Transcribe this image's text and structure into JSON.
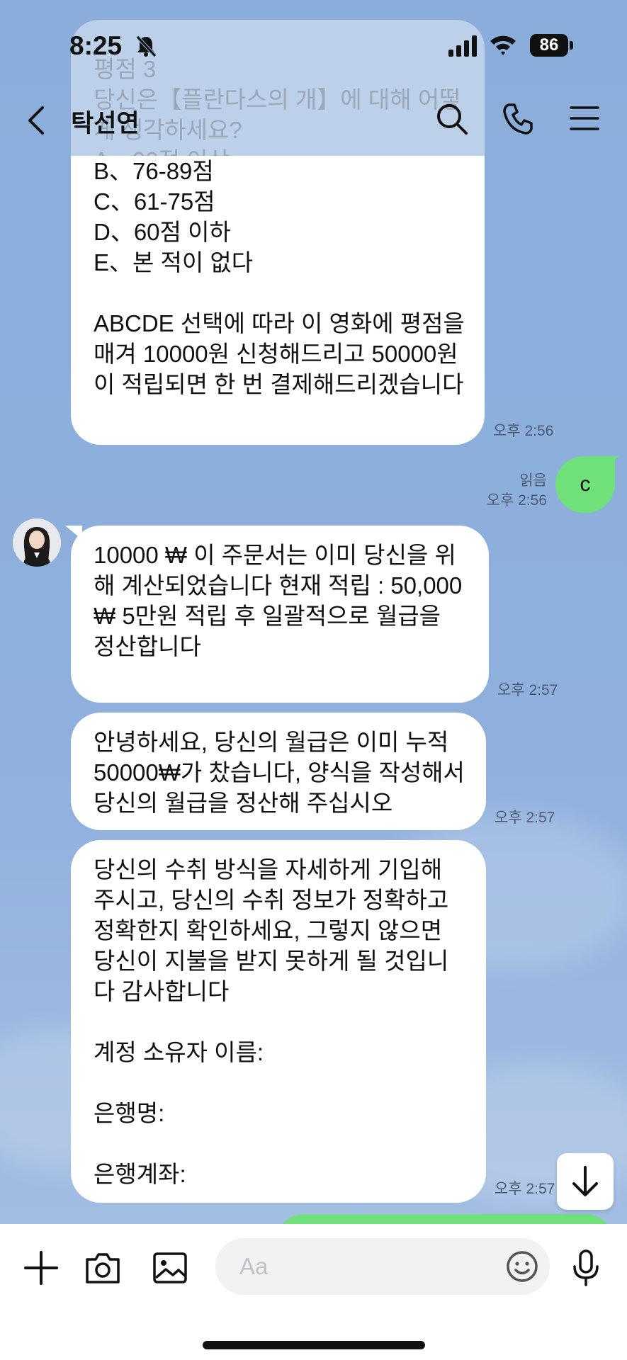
{
  "status": {
    "time": "8:25",
    "battery": "86"
  },
  "header": {
    "contact_name": "탁선연"
  },
  "messages": {
    "faded_top_text": "평점 3\n당신은【플란다스의 개】에 대해 어떻게 생각하세요?\nA、90점 이상",
    "first_bubble_text": "B、76-89점\nC、61-75점\nD、60점 이하\nE、본 적이 없다\n\nABCDE 선택에 따라 이 영화에 평점을 매겨 10000원 신청해드리고 50000원이 적립되면 한 번 결제해드리겠습니다",
    "first_time": "오후 2:56",
    "sent_text": "c",
    "sent_read": "읽음",
    "sent_time": "오후 2:56",
    "msg2_text": "10000 ₩ 이 주문서는 이미 당신을 위해 계산되었습니다  현재 적립 : 50,000 ₩ 5만원 적립 후 일괄적으로 월급을 정산합니다",
    "msg2_time": "오후 2:57",
    "msg3_text": "안녕하세요, 당신의 월급은 이미 누적 50000₩가 찼습니다, 양식을 작성해서 당신의 월급을 정산해 주십시오",
    "msg3_time": "오후 2:57",
    "msg4_text": "당신의 수취 방식을 자세하게 기입해 주시고, 당신의 수취 정보가 정확하고 정확한지 확인하세요, 그렇지 않으면 당신이 지불을 받지 못하게 될 것입니다 감사합니다\n\n계정 소유자 이름:\n\n은행명:\n\n은행계좌:",
    "msg4_time": "오후 2:57"
  },
  "input": {
    "placeholder": "Aa"
  },
  "icons": {
    "back": "chevron-left-icon",
    "search": "search-icon",
    "call": "phone-icon",
    "menu": "menu-icon",
    "plus": "plus-icon",
    "camera": "camera-icon",
    "gallery": "image-icon",
    "emoji": "emoji-icon",
    "mic": "microphone-icon",
    "scroll": "arrow-down-icon",
    "mute": "bell-off-icon"
  },
  "colors": {
    "chat_background": "#8eafdc",
    "sent_bubble": "#6fe07a",
    "received_bubble": "#ffffff"
  }
}
